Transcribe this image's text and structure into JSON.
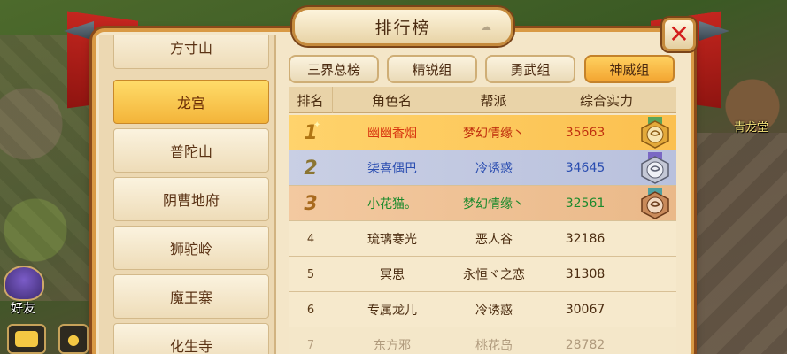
{
  "window": {
    "title": "排行榜"
  },
  "background": {
    "side_label": "青龙堂"
  },
  "hud": {
    "friend_label": "好友"
  },
  "sidebar": {
    "items": [
      {
        "label": "方寸山",
        "active": false
      },
      {
        "label": "龙宫",
        "active": true
      },
      {
        "label": "普陀山",
        "active": false
      },
      {
        "label": "阴曹地府",
        "active": false
      },
      {
        "label": "狮驼岭",
        "active": false
      },
      {
        "label": "魔王寨",
        "active": false
      },
      {
        "label": "化生寺",
        "active": false
      }
    ]
  },
  "tabs": [
    {
      "label": "三界总榜",
      "active": false
    },
    {
      "label": "精锐组",
      "active": false
    },
    {
      "label": "勇武组",
      "active": false
    },
    {
      "label": "神威组",
      "active": true
    }
  ],
  "table": {
    "headers": [
      "排名",
      "角色名",
      "帮派",
      "综合实力"
    ],
    "rows": [
      {
        "rank": "1",
        "name": "幽幽香烟",
        "guild": "梦幻情缘丶",
        "power": "35663"
      },
      {
        "rank": "2",
        "name": "柒喜偶巴",
        "guild": "冷诱惑",
        "power": "34645"
      },
      {
        "rank": "3",
        "name": "小花猫。",
        "guild": "梦幻情缘丶",
        "power": "32561"
      },
      {
        "rank": "4",
        "name": "琉璃寒光",
        "guild": "恶人谷",
        "power": "32186"
      },
      {
        "rank": "5",
        "name": "冥思",
        "guild": "永恒ヾ之恋",
        "power": "31308"
      },
      {
        "rank": "6",
        "name": "专属龙儿",
        "guild": "冷诱惑",
        "power": "30067"
      },
      {
        "rank": "7",
        "name": "东方邪",
        "guild": "桃花岛",
        "power": "28782"
      }
    ]
  },
  "colors": {
    "gold": "#ffd36c",
    "silver": "#c9cfe4",
    "bronze": "#f3c9a0",
    "close": "#d31d1d"
  }
}
